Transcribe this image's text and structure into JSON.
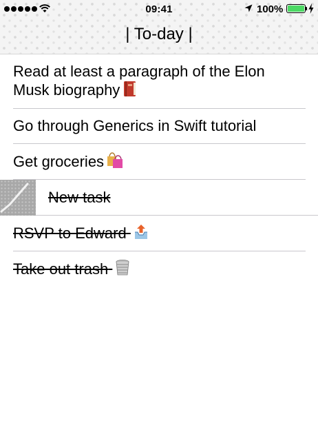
{
  "status_bar": {
    "time": "09:41",
    "battery_percent": "100%",
    "battery_level": 1.0,
    "signal_dots": 5,
    "icons": [
      "signal-dots-icon",
      "wifi-icon",
      "location-arrow-icon",
      "battery-icon",
      "charging-bolt-icon"
    ]
  },
  "header": {
    "title": "| To-day |"
  },
  "tasks": [
    {
      "text": "Read at least a paragraph of the Elon",
      "text_line2": "Musk biography",
      "emoji": "red-book-icon",
      "completed": false
    },
    {
      "text": "Go through Generics in Swift tutorial",
      "completed": false
    },
    {
      "text": "Get groceries",
      "emoji": "shopping-bags-icon",
      "completed": false
    },
    {
      "text": "New task",
      "completed": true,
      "swiped": true,
      "swipe_action_icon": "checkmark-icon"
    },
    {
      "text": "RSVP to Edward",
      "emoji": "outbox-tray-icon",
      "completed": true
    },
    {
      "text": "Take out trash",
      "emoji": "wastebasket-icon",
      "completed": true
    }
  ],
  "colors": {
    "divider": "#c8c7cc",
    "battery_fill": "#4cd964",
    "swipe_action_bg": "#a8a8a8",
    "book_red": "#c0392b",
    "bag_pink": "#e24aa6"
  }
}
